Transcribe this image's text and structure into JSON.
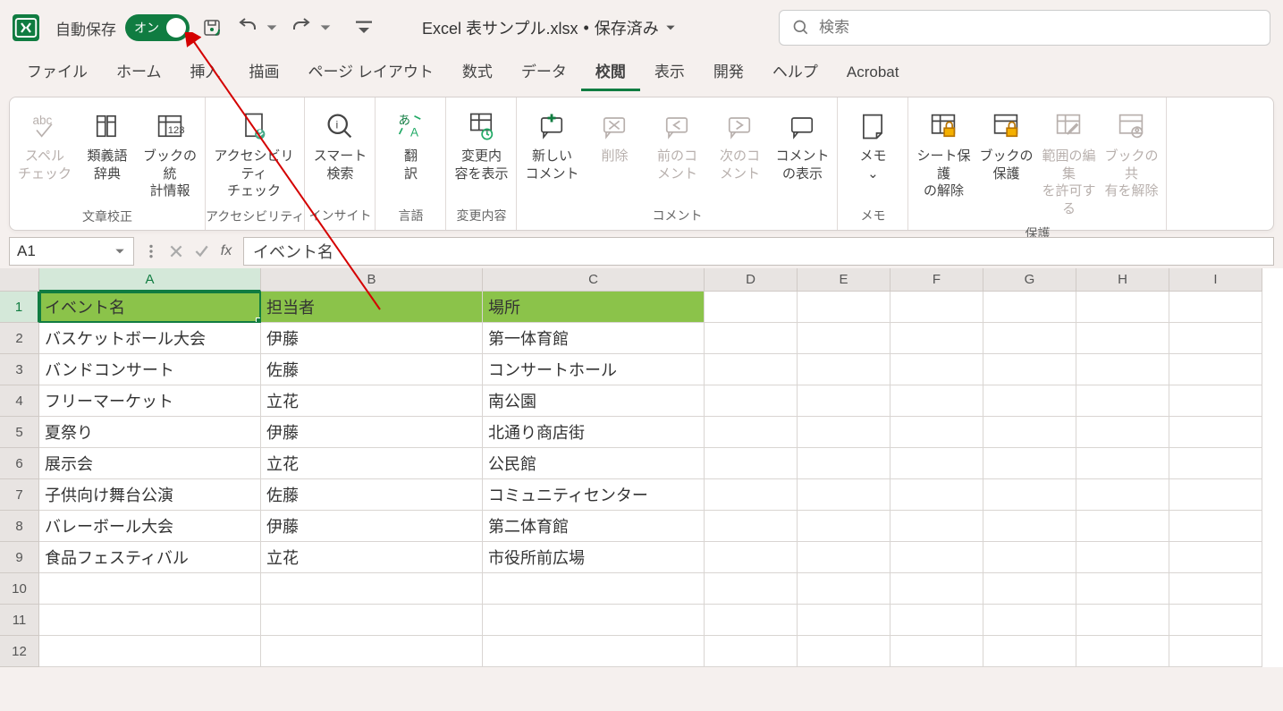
{
  "titlebar": {
    "autosave_label": "自動保存",
    "toggle_text": "オン",
    "filename": "Excel 表サンプル.xlsx",
    "save_status": "保存済み",
    "search_placeholder": "検索"
  },
  "tabs": [
    "ファイル",
    "ホーム",
    "挿入",
    "描画",
    "ページ レイアウト",
    "数式",
    "データ",
    "校閲",
    "表示",
    "開発",
    "ヘルプ",
    "Acrobat"
  ],
  "active_tab": 7,
  "ribbon_groups": [
    {
      "label": "文章校正",
      "items": [
        {
          "name": "spell-check",
          "label": "スペル\nチェック",
          "disabled": true
        },
        {
          "name": "thesaurus",
          "label": "類義語\n辞典"
        },
        {
          "name": "workbook-stats",
          "label": "ブックの統\n計情報"
        }
      ]
    },
    {
      "label": "アクセシビリティ",
      "items": [
        {
          "name": "accessibility-check",
          "label": "アクセシビリティ\nチェック"
        }
      ]
    },
    {
      "label": "インサイト",
      "items": [
        {
          "name": "smart-lookup",
          "label": "スマート\n検索"
        }
      ]
    },
    {
      "label": "言語",
      "items": [
        {
          "name": "translate",
          "label": "翻\n訳"
        }
      ]
    },
    {
      "label": "変更内容",
      "items": [
        {
          "name": "show-changes",
          "label": "変更内\n容を表示"
        }
      ]
    },
    {
      "label": "コメント",
      "items": [
        {
          "name": "new-comment",
          "label": "新しい\nコメント"
        },
        {
          "name": "delete-comment",
          "label": "削除",
          "disabled": true
        },
        {
          "name": "prev-comment",
          "label": "前のコ\nメント",
          "disabled": true
        },
        {
          "name": "next-comment",
          "label": "次のコ\nメント",
          "disabled": true
        },
        {
          "name": "show-comments",
          "label": "コメント\nの表示"
        }
      ]
    },
    {
      "label": "メモ",
      "items": [
        {
          "name": "notes",
          "label": "メモ\n⌄"
        }
      ]
    },
    {
      "label": "保護",
      "items": [
        {
          "name": "unprotect-sheet",
          "label": "シート保護\nの解除"
        },
        {
          "name": "protect-workbook",
          "label": "ブックの\n保護"
        },
        {
          "name": "allow-edit-ranges",
          "label": "範囲の編集\nを許可する",
          "disabled": true
        },
        {
          "name": "unshare-workbook",
          "label": "ブックの共\n有を解除",
          "disabled": true
        }
      ]
    }
  ],
  "name_box": "A1",
  "formula_value": "イベント名",
  "columns": [
    "A",
    "B",
    "C",
    "D",
    "E",
    "F",
    "G",
    "H",
    "I"
  ],
  "active_col": 0,
  "active_row": 1,
  "rows": [
    {
      "n": 1,
      "cells": [
        "イベント名",
        "担当者",
        "場所"
      ],
      "header": true
    },
    {
      "n": 2,
      "cells": [
        "バスケットボール大会",
        "伊藤",
        "第一体育館"
      ]
    },
    {
      "n": 3,
      "cells": [
        "バンドコンサート",
        "佐藤",
        "コンサートホール"
      ]
    },
    {
      "n": 4,
      "cells": [
        "フリーマーケット",
        "立花",
        "南公園"
      ]
    },
    {
      "n": 5,
      "cells": [
        "夏祭り",
        "伊藤",
        "北通り商店街"
      ]
    },
    {
      "n": 6,
      "cells": [
        "展示会",
        "立花",
        "公民館"
      ]
    },
    {
      "n": 7,
      "cells": [
        "子供向け舞台公演",
        "佐藤",
        "コミュニティセンター"
      ]
    },
    {
      "n": 8,
      "cells": [
        "バレーボール大会",
        "伊藤",
        "第二体育館"
      ]
    },
    {
      "n": 9,
      "cells": [
        "食品フェスティバル",
        "立花",
        "市役所前広場"
      ]
    },
    {
      "n": 10,
      "cells": []
    },
    {
      "n": 11,
      "cells": []
    },
    {
      "n": 12,
      "cells": []
    }
  ]
}
